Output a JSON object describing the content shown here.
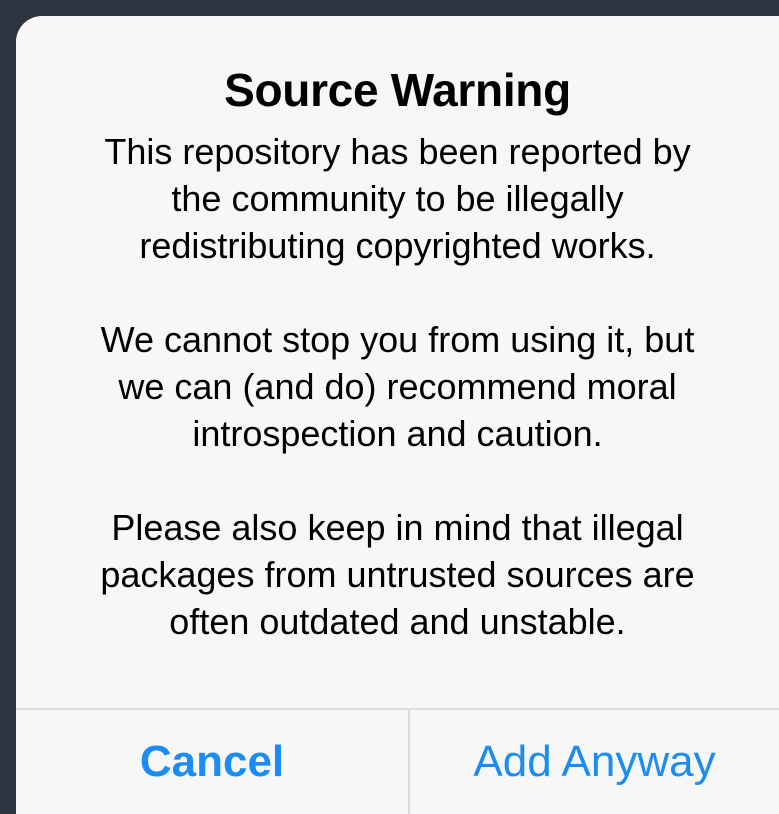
{
  "alert": {
    "title": "Source Warning",
    "message": [
      [
        "This repository has been reported by",
        "the community to be illegally",
        "redistributing copyrighted works."
      ],
      [
        "We cannot stop you from using it, but",
        "we can (and do) recommend moral",
        "introspection and caution."
      ],
      [
        "Please also keep in mind that illegal",
        "packages from untrusted sources are",
        "often outdated and unstable."
      ]
    ],
    "cancel_label": "Cancel",
    "confirm_label": "Add Anyway"
  },
  "colors": {
    "backdrop": "#2d3440",
    "alert_background": "#f7f7f7",
    "button_text": "#1a8cf2",
    "divider": "#dbdbdf"
  }
}
